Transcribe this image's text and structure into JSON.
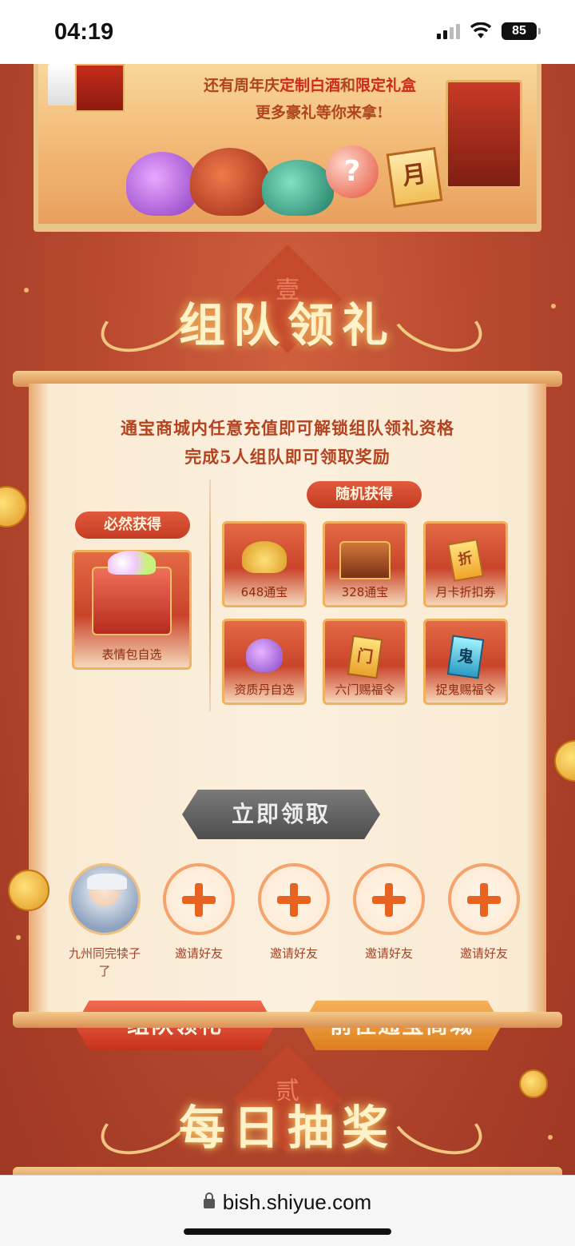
{
  "status_bar": {
    "time": "04:19",
    "battery": "85"
  },
  "banner": {
    "line1_prefix": "还有周年庆",
    "line1_hl1": "定制白酒",
    "line1_mid": "和",
    "line1_hl2": "限定礼盒",
    "line2": "更多豪礼等你来拿!",
    "yue_char": "月",
    "orb_char": "?"
  },
  "section1": {
    "seal_char": "壹",
    "title": "组队领礼"
  },
  "panel": {
    "intro_line1": "通宝商城内任意充值即可解锁组队领礼资格",
    "intro_line2": "完成5人组队即可领取奖励",
    "guaranteed_label": "必然获得",
    "guaranteed_item": "表情包自选",
    "random_label": "随机获得",
    "random_items": [
      {
        "label": "648通宝",
        "icon": "coins-icon"
      },
      {
        "label": "328通宝",
        "icon": "chest-icon"
      },
      {
        "label": "月卡折扣券",
        "icon": "discount-ticket-icon",
        "glyph": "折"
      },
      {
        "label": "资质丹自选",
        "icon": "pouch-icon"
      },
      {
        "label": "六门赐福令",
        "icon": "gold-token-icon",
        "glyph": "门"
      },
      {
        "label": "捉鬼赐福令",
        "icon": "blue-token-icon",
        "glyph": "鬼"
      }
    ],
    "claim_button": "立即领取",
    "members": [
      {
        "name": "九州同完犊子了",
        "type": "avatar"
      },
      {
        "name": "邀请好友",
        "type": "invite"
      },
      {
        "name": "邀请好友",
        "type": "invite"
      },
      {
        "name": "邀请好友",
        "type": "invite"
      },
      {
        "name": "邀请好友",
        "type": "invite"
      }
    ],
    "team_button": "组队领礼",
    "shop_button": "前往通宝商城"
  },
  "section2": {
    "seal_char": "贰",
    "title": "每日抽奖"
  },
  "browser": {
    "url": "bish.shiyue.com"
  },
  "colors": {
    "accent_red": "#c7311c",
    "accent_gold": "#dd7d1d",
    "panel_bg": "#fbf0de",
    "text_brown": "#b4421f"
  }
}
